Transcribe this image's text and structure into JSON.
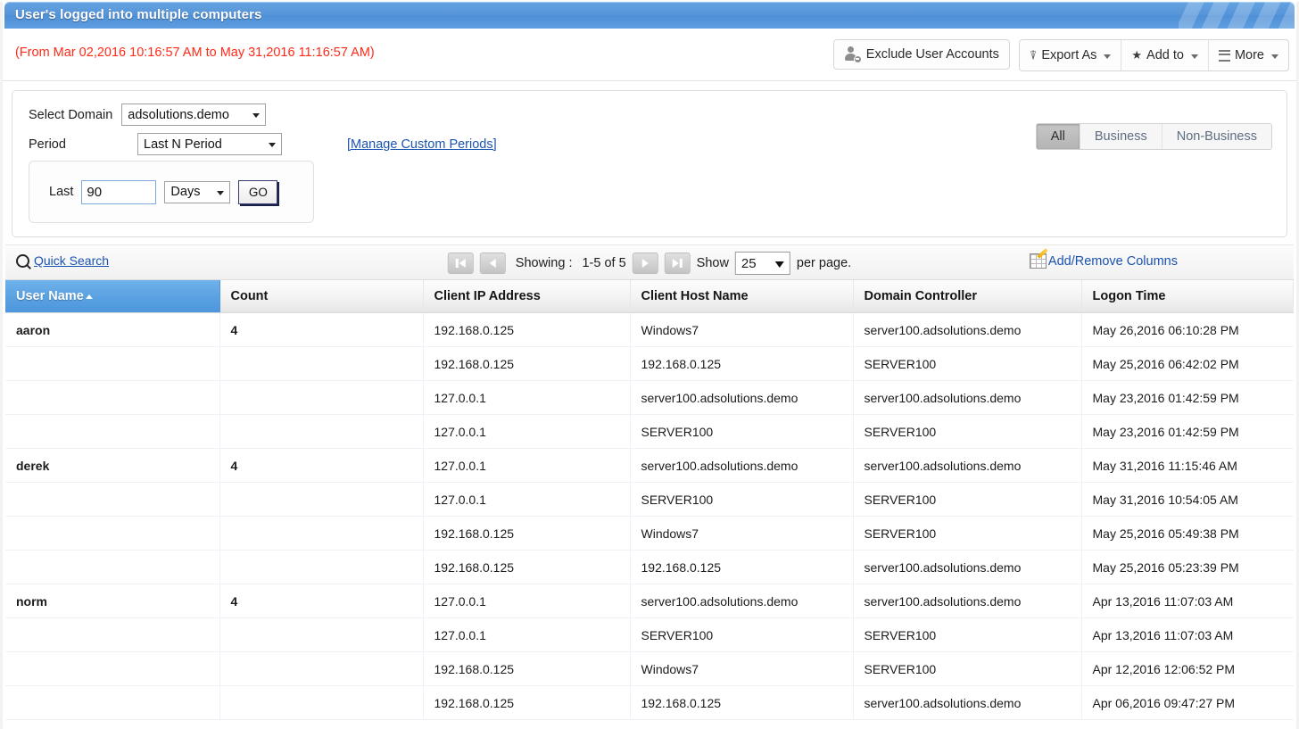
{
  "window": {
    "title": "User's logged into multiple computers"
  },
  "header": {
    "date_range": "(From Mar 02,2016 10:16:57 AM to May 31,2016 11:16:57 AM)",
    "exclude_button": "Exclude User Accounts",
    "export_button": "Export As",
    "add_to_button": "Add to",
    "more_button": "More"
  },
  "filters": {
    "domain_label": "Select Domain",
    "domain_value": "adsolutions.demo",
    "period_label": "Period",
    "period_value": "Last N Period",
    "manage_custom_periods": "[Manage Custom Periods]",
    "last_label": "Last",
    "last_value": "90",
    "unit_value": "Days",
    "go_button": "GO",
    "segments": [
      {
        "label": "All",
        "active": true
      },
      {
        "label": "Business",
        "active": false
      },
      {
        "label": "Non-Business",
        "active": false
      }
    ]
  },
  "table_toolbar": {
    "quick_search": "Quick Search",
    "showing_label": "Showing :",
    "showing_range": "1-5 of 5",
    "show_label": "Show",
    "per_page_value": "25",
    "per_page_suffix": "per page.",
    "add_remove_columns": "Add/Remove Columns"
  },
  "table": {
    "columns": [
      {
        "label": "User Name",
        "sorted": true,
        "sort_dir": "asc"
      },
      {
        "label": "Count",
        "sorted": false
      },
      {
        "label": "Client IP Address",
        "sorted": false
      },
      {
        "label": "Client Host Name",
        "sorted": false
      },
      {
        "label": "Domain Controller",
        "sorted": false
      },
      {
        "label": "Logon Time",
        "sorted": false
      }
    ],
    "rows": [
      {
        "user": "aaron",
        "count": "4",
        "ip": "192.168.0.125",
        "host": "Windows7",
        "dc": "server100.adsolutions.demo",
        "time": "May 26,2016 06:10:28 PM"
      },
      {
        "user": "",
        "count": "",
        "ip": "192.168.0.125",
        "host": "192.168.0.125",
        "dc": "SERVER100",
        "time": "May 25,2016 06:42:02 PM"
      },
      {
        "user": "",
        "count": "",
        "ip": "127.0.0.1",
        "host": "server100.adsolutions.demo",
        "dc": "server100.adsolutions.demo",
        "time": "May 23,2016 01:42:59 PM"
      },
      {
        "user": "",
        "count": "",
        "ip": "127.0.0.1",
        "host": "SERVER100",
        "dc": "SERVER100",
        "time": "May 23,2016 01:42:59 PM"
      },
      {
        "user": "derek",
        "count": "4",
        "ip": "127.0.0.1",
        "host": "server100.adsolutions.demo",
        "dc": "server100.adsolutions.demo",
        "time": "May 31,2016 11:15:46 AM"
      },
      {
        "user": "",
        "count": "",
        "ip": "127.0.0.1",
        "host": "SERVER100",
        "dc": "SERVER100",
        "time": "May 31,2016 10:54:05 AM"
      },
      {
        "user": "",
        "count": "",
        "ip": "192.168.0.125",
        "host": "Windows7",
        "dc": "SERVER100",
        "time": "May 25,2016 05:49:38 PM"
      },
      {
        "user": "",
        "count": "",
        "ip": "192.168.0.125",
        "host": "192.168.0.125",
        "dc": "server100.adsolutions.demo",
        "time": "May 25,2016 05:23:39 PM"
      },
      {
        "user": "norm",
        "count": "4",
        "ip": "127.0.0.1",
        "host": "server100.adsolutions.demo",
        "dc": "server100.adsolutions.demo",
        "time": "Apr 13,2016 11:07:03 AM"
      },
      {
        "user": "",
        "count": "",
        "ip": "127.0.0.1",
        "host": "SERVER100",
        "dc": "SERVER100",
        "time": "Apr 13,2016 11:07:03 AM"
      },
      {
        "user": "",
        "count": "",
        "ip": "192.168.0.125",
        "host": "Windows7",
        "dc": "SERVER100",
        "time": "Apr 12,2016 12:06:52 PM"
      },
      {
        "user": "",
        "count": "",
        "ip": "192.168.0.125",
        "host": "192.168.0.125",
        "dc": "server100.adsolutions.demo",
        "time": "Apr 06,2016 09:47:27 PM"
      }
    ]
  },
  "colors": {
    "title_blue": "#5795da",
    "header_sorted_blue": "#5aa1e2",
    "date_red": "#ff2a18",
    "link_blue": "#1a53b0"
  }
}
